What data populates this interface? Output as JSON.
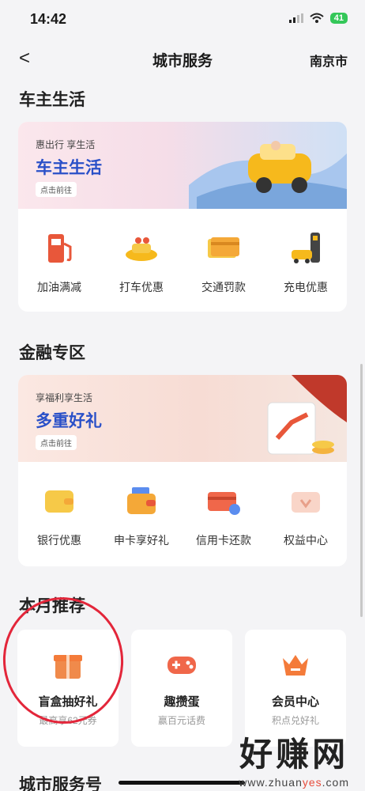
{
  "status": {
    "time": "14:42",
    "battery": "41"
  },
  "nav": {
    "back": "<",
    "title": "城市服务",
    "city": "南京市"
  },
  "car": {
    "section_title": "车主生活",
    "banner_small": "惠出行 享生活",
    "banner_big": "车主生活",
    "banner_button": "点击前往",
    "items": [
      {
        "label": "加油满减"
      },
      {
        "label": "打车优惠"
      },
      {
        "label": "交通罚款"
      },
      {
        "label": "充电优惠"
      }
    ]
  },
  "finance": {
    "section_title": "金融专区",
    "banner_small": "享福利享生活",
    "banner_big": "多重好礼",
    "banner_button": "点击前往",
    "items": [
      {
        "label": "银行优惠"
      },
      {
        "label": "申卡享好礼"
      },
      {
        "label": "信用卡还款"
      },
      {
        "label": "权益中心"
      }
    ]
  },
  "recommend": {
    "section_title": "本月推荐",
    "items": [
      {
        "title": "盲盒抽好礼",
        "subtitle": "最高享62元券"
      },
      {
        "title": "趣攒蛋",
        "subtitle": "赢百元话费"
      },
      {
        "title": "会员中心",
        "subtitle": "积点兑好礼"
      }
    ]
  },
  "city_service": {
    "section_title": "城市服务号"
  },
  "watermark": {
    "big": "好赚网",
    "small_prefix": "www.zhuan",
    "small_highlight": "yes",
    "small_suffix": ".com"
  }
}
